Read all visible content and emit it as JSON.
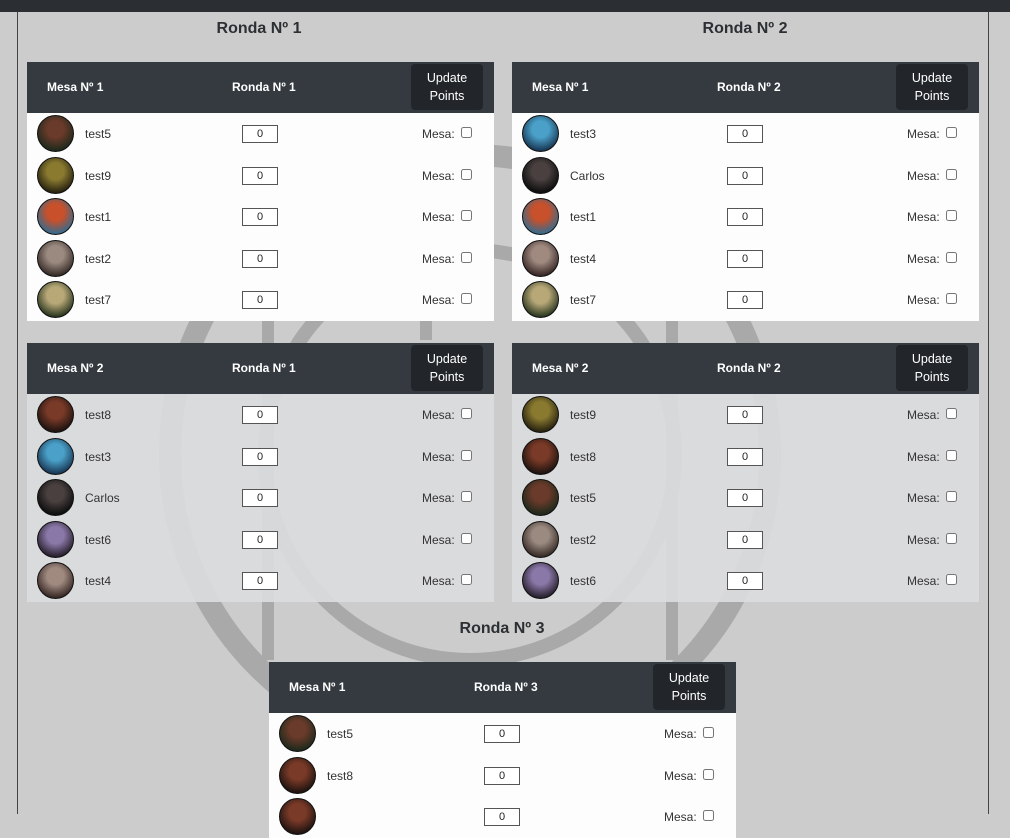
{
  "rounds": [
    {
      "title": "Ronda Nº 1"
    },
    {
      "title": "Ronda Nº 2"
    },
    {
      "title": "Ronda Nº 3"
    }
  ],
  "labels": {
    "update_button": "Update Points",
    "mesa_checkbox": "Mesa:",
    "points_default": "0"
  },
  "tables": [
    {
      "mesa": "Mesa Nº 1",
      "ronda": "Ronda Nº 1",
      "style": "white",
      "players": [
        {
          "name": "test5",
          "avatar": "avatar-knight-red",
          "colors": [
            "#6a3a2a",
            "#1f2a1c"
          ]
        },
        {
          "name": "test9",
          "avatar": "avatar-warrior-gold",
          "colors": [
            "#8a7a30",
            "#2a2410"
          ]
        },
        {
          "name": "test1",
          "avatar": "avatar-mage-fire",
          "colors": [
            "#c8502a",
            "#3a6a8a"
          ]
        },
        {
          "name": "test2",
          "avatar": "avatar-elder-grey",
          "colors": [
            "#9a8a80",
            "#3a2e2a"
          ]
        },
        {
          "name": "test7",
          "avatar": "avatar-hunter-green",
          "colors": [
            "#b8a878",
            "#2e3a22"
          ]
        }
      ]
    },
    {
      "mesa": "Mesa Nº 1",
      "ronda": "Ronda Nº 2",
      "style": "white",
      "players": [
        {
          "name": "test3",
          "avatar": "avatar-elf-blue",
          "colors": [
            "#4aa0c8",
            "#1a3a58"
          ]
        },
        {
          "name": "Carlos",
          "avatar": "avatar-photo-dark",
          "colors": [
            "#4a4040",
            "#0e0e0e"
          ]
        },
        {
          "name": "test1",
          "avatar": "avatar-mage-fire",
          "colors": [
            "#c8502a",
            "#3a6a8a"
          ]
        },
        {
          "name": "test4",
          "avatar": "avatar-elder-grey",
          "colors": [
            "#a08a80",
            "#3a2a28"
          ]
        },
        {
          "name": "test7",
          "avatar": "avatar-hunter-green",
          "colors": [
            "#b8a878",
            "#2e3a22"
          ]
        }
      ]
    },
    {
      "mesa": "Mesa Nº 2",
      "ronda": "Ronda Nº 1",
      "style": "grey",
      "players": [
        {
          "name": "test8",
          "avatar": "avatar-shadow-brown",
          "colors": [
            "#7a3a28",
            "#201410"
          ]
        },
        {
          "name": "test3",
          "avatar": "avatar-elf-blue",
          "colors": [
            "#4aa0c8",
            "#1a3a58"
          ]
        },
        {
          "name": "Carlos",
          "avatar": "avatar-photo-dark",
          "colors": [
            "#4a4040",
            "#0e0e0e"
          ]
        },
        {
          "name": "test6",
          "avatar": "avatar-soldier-purple",
          "colors": [
            "#8a78a8",
            "#2a2230"
          ]
        },
        {
          "name": "test4",
          "avatar": "avatar-elder-grey",
          "colors": [
            "#a08a80",
            "#3a2a28"
          ]
        }
      ]
    },
    {
      "mesa": "Mesa Nº 2",
      "ronda": "Ronda Nº 2",
      "style": "grey",
      "players": [
        {
          "name": "test9",
          "avatar": "avatar-warrior-gold",
          "colors": [
            "#8a7a30",
            "#2a2410"
          ]
        },
        {
          "name": "test8",
          "avatar": "avatar-shadow-brown",
          "colors": [
            "#7a3a28",
            "#201410"
          ]
        },
        {
          "name": "test5",
          "avatar": "avatar-knight-red",
          "colors": [
            "#6a3a2a",
            "#1f2a1c"
          ]
        },
        {
          "name": "test2",
          "avatar": "avatar-elder-grey",
          "colors": [
            "#9a8a80",
            "#3a2e2a"
          ]
        },
        {
          "name": "test6",
          "avatar": "avatar-soldier-purple",
          "colors": [
            "#8a78a8",
            "#2a2230"
          ]
        }
      ]
    },
    {
      "mesa": "Mesa Nº 1",
      "ronda": "Ronda Nº 3",
      "style": "white",
      "players": [
        {
          "name": "test5",
          "avatar": "avatar-knight-red",
          "colors": [
            "#6a3a2a",
            "#1f2a1c"
          ]
        },
        {
          "name": "test8",
          "avatar": "avatar-shadow-brown",
          "colors": [
            "#7a3a28",
            "#201410"
          ]
        },
        {
          "name": "",
          "avatar": "avatar-shadow-brown",
          "colors": [
            "#7a3a28",
            "#201410"
          ]
        }
      ]
    }
  ]
}
